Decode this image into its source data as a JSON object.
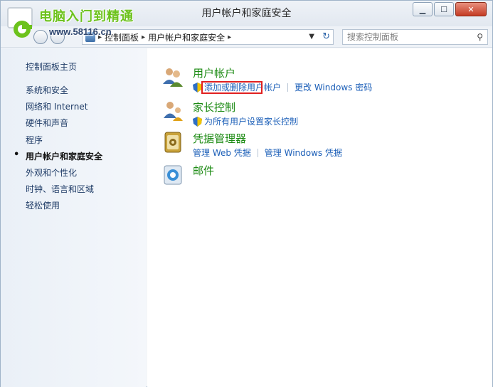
{
  "window": {
    "title": "用户帐户和家庭安全"
  },
  "watermark": {
    "line1": "电脑入门到精通",
    "line2": "www.58116.cn"
  },
  "address": {
    "crumbs": [
      "控制面板",
      "用户帐户和家庭安全"
    ]
  },
  "search": {
    "placeholder": "搜索控制面板"
  },
  "sidebar": {
    "home": "控制面板主页",
    "items": [
      {
        "label": "系统和安全",
        "active": false
      },
      {
        "label": "网络和 Internet",
        "active": false
      },
      {
        "label": "硬件和声音",
        "active": false
      },
      {
        "label": "程序",
        "active": false
      },
      {
        "label": "用户帐户和家庭安全",
        "active": true
      },
      {
        "label": "外观和个性化",
        "active": false
      },
      {
        "label": "时钟、语言和区域",
        "active": false
      },
      {
        "label": "轻松使用",
        "active": false
      }
    ]
  },
  "categories": [
    {
      "title": "用户帐户",
      "icon": "user-accounts-icon",
      "links": [
        "添加或删除用户帐户",
        "更改 Windows 密码"
      ]
    },
    {
      "title": "家长控制",
      "icon": "parental-controls-icon",
      "links": [
        "为所有用户设置家长控制"
      ]
    },
    {
      "title": "凭据管理器",
      "icon": "credential-manager-icon",
      "links": [
        "管理 Web 凭据",
        "管理 Windows 凭据"
      ]
    },
    {
      "title": "邮件",
      "icon": "mail-icon",
      "links": []
    }
  ],
  "colors": {
    "category_title": "#1b8a12",
    "link": "#1c5fb8",
    "highlight_box": "#e02020"
  }
}
